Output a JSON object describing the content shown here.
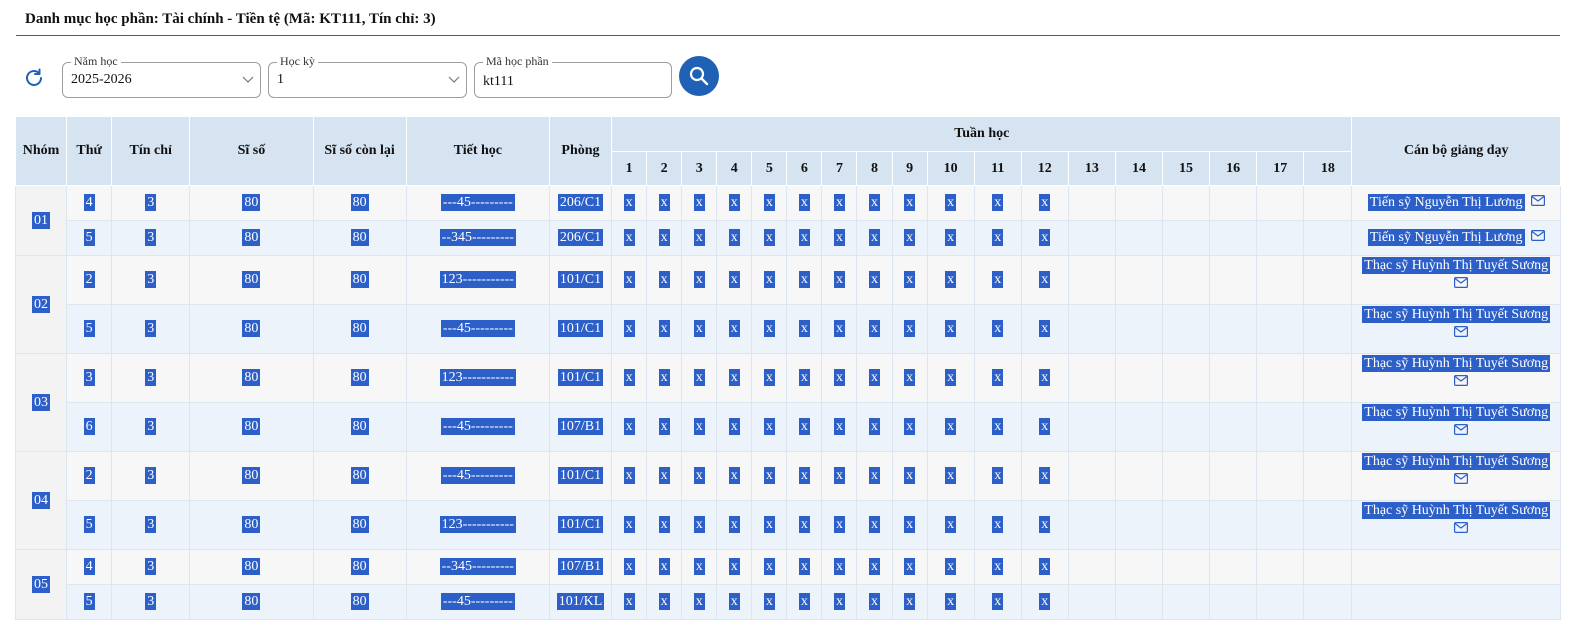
{
  "page": {
    "title": "Danh mục học phần: Tài chính - Tiền tệ (Mã: KT111, Tín chỉ: 3)"
  },
  "filters": {
    "year": {
      "label": "Năm học",
      "value": "2025-2026"
    },
    "semester": {
      "label": "Học kỳ",
      "value": "1"
    },
    "course_code": {
      "label": "Mã học phần",
      "value": "kt111"
    }
  },
  "table": {
    "headers": {
      "group": "Nhóm",
      "day": "Thứ",
      "credits": "Tín chỉ",
      "capacity": "Sĩ số",
      "remaining": "Sĩ số còn lại",
      "periods": "Tiết học",
      "room": "Phòng",
      "weeks": "Tuần học",
      "teacher": "Cán bộ giảng dạy"
    },
    "week_numbers": [
      "1",
      "2",
      "3",
      "4",
      "5",
      "6",
      "7",
      "8",
      "9",
      "10",
      "11",
      "12",
      "13",
      "14",
      "15",
      "16",
      "17",
      "18"
    ],
    "groups": [
      {
        "group": "01",
        "rows": [
          {
            "day": "4",
            "credits": "3",
            "capacity": "80",
            "remaining": "80",
            "periods": "---45---------",
            "room": "206/C1",
            "weeks": [
              "x",
              "x",
              "x",
              "x",
              "x",
              "x",
              "x",
              "x",
              "x",
              "x",
              "x",
              "x"
            ],
            "teacher": "Tiến sỹ Nguyễn Thị Lương"
          },
          {
            "day": "5",
            "credits": "3",
            "capacity": "80",
            "remaining": "80",
            "periods": "--345---------",
            "room": "206/C1",
            "weeks": [
              "x",
              "x",
              "x",
              "x",
              "x",
              "x",
              "x",
              "x",
              "x",
              "x",
              "x",
              "x"
            ],
            "teacher": "Tiến sỹ Nguyễn Thị Lương"
          }
        ]
      },
      {
        "group": "02",
        "rows": [
          {
            "day": "2",
            "credits": "3",
            "capacity": "80",
            "remaining": "80",
            "periods": "123-----------",
            "room": "101/C1",
            "weeks": [
              "x",
              "x",
              "x",
              "x",
              "x",
              "x",
              "x",
              "x",
              "x",
              "x",
              "x",
              "x"
            ],
            "teacher": "Thạc sỹ Huỳnh Thị Tuyết Sương"
          },
          {
            "day": "5",
            "credits": "3",
            "capacity": "80",
            "remaining": "80",
            "periods": "---45---------",
            "room": "101/C1",
            "weeks": [
              "x",
              "x",
              "x",
              "x",
              "x",
              "x",
              "x",
              "x",
              "x",
              "x",
              "x",
              "x"
            ],
            "teacher": "Thạc sỹ Huỳnh Thị Tuyết Sương"
          }
        ]
      },
      {
        "group": "03",
        "rows": [
          {
            "day": "3",
            "credits": "3",
            "capacity": "80",
            "remaining": "80",
            "periods": "123-----------",
            "room": "101/C1",
            "weeks": [
              "x",
              "x",
              "x",
              "x",
              "x",
              "x",
              "x",
              "x",
              "x",
              "x",
              "x",
              "x"
            ],
            "teacher": "Thạc sỹ Huỳnh Thị Tuyết Sương"
          },
          {
            "day": "6",
            "credits": "3",
            "capacity": "80",
            "remaining": "80",
            "periods": "---45---------",
            "room": "107/B1",
            "weeks": [
              "x",
              "x",
              "x",
              "x",
              "x",
              "x",
              "x",
              "x",
              "x",
              "x",
              "x",
              "x"
            ],
            "teacher": "Thạc sỹ Huỳnh Thị Tuyết Sương"
          }
        ]
      },
      {
        "group": "04",
        "rows": [
          {
            "day": "2",
            "credits": "3",
            "capacity": "80",
            "remaining": "80",
            "periods": "---45---------",
            "room": "101/C1",
            "weeks": [
              "x",
              "x",
              "x",
              "x",
              "x",
              "x",
              "x",
              "x",
              "x",
              "x",
              "x",
              "x"
            ],
            "teacher": "Thạc sỹ Huỳnh Thị Tuyết Sương"
          },
          {
            "day": "5",
            "credits": "3",
            "capacity": "80",
            "remaining": "80",
            "periods": "123-----------",
            "room": "101/C1",
            "weeks": [
              "x",
              "x",
              "x",
              "x",
              "x",
              "x",
              "x",
              "x",
              "x",
              "x",
              "x",
              "x"
            ],
            "teacher": "Thạc sỹ Huỳnh Thị Tuyết Sương"
          }
        ]
      },
      {
        "group": "05",
        "rows": [
          {
            "day": "4",
            "credits": "3",
            "capacity": "80",
            "remaining": "80",
            "periods": "--345---------",
            "room": "107/B1",
            "weeks": [
              "x",
              "x",
              "x",
              "x",
              "x",
              "x",
              "x",
              "x",
              "x",
              "x",
              "x",
              "x"
            ],
            "teacher": ""
          },
          {
            "day": "5",
            "credits": "3",
            "capacity": "80",
            "remaining": "80",
            "periods": "---45---------",
            "room": "101/KL",
            "weeks": [
              "x",
              "x",
              "x",
              "x",
              "x",
              "x",
              "x",
              "x",
              "x",
              "x",
              "x",
              "x"
            ],
            "teacher": ""
          }
        ]
      }
    ]
  },
  "icons": {
    "refresh": "refresh-icon",
    "search": "search-icon",
    "mail": "mail-icon",
    "chevron": "chevron-down-icon"
  },
  "colors": {
    "accent": "#1f62b5",
    "header_bg": "#d6e4f2",
    "highlight": "#2d5fc8"
  }
}
